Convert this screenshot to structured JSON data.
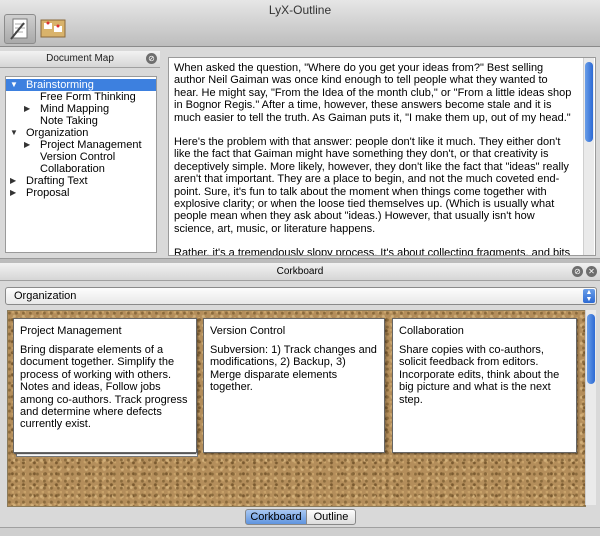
{
  "window": {
    "title": "LyX-Outline"
  },
  "document_map": {
    "header": "Document Map",
    "items": [
      {
        "label": "Brainstorming",
        "level": 0,
        "toggle": "expanded",
        "selected": true
      },
      {
        "label": "Free Form Thinking",
        "level": 1,
        "toggle": "none"
      },
      {
        "label": "Mind Mapping",
        "level": 1,
        "toggle": "collapsed"
      },
      {
        "label": "Note Taking",
        "level": 1,
        "toggle": "none"
      },
      {
        "label": "Organization",
        "level": 0,
        "toggle": "expanded"
      },
      {
        "label": "Project Management",
        "level": 1,
        "toggle": "collapsed"
      },
      {
        "label": "Version Control",
        "level": 1,
        "toggle": "none"
      },
      {
        "label": "Collaboration",
        "level": 1,
        "toggle": "none"
      },
      {
        "label": "Drafting Text",
        "level": 0,
        "toggle": "collapsed"
      },
      {
        "label": "Proposal",
        "level": 0,
        "toggle": "collapsed"
      }
    ]
  },
  "editor": {
    "paragraphs": [
      "When asked the question, \"Where do you get your ideas from?\"  Best selling author Neil Gaiman was once kind enough to tell people what they wanted to hear.  He might say, \"From the Idea of the month club,\" or \"From a little ideas shop in Bognor Regis.\"  After a time, however, these answers become stale and it is much easier to tell the truth.  As Gaiman puts it, \"I make them up, out of my head.\"",
      "Here's the problem with that answer: people don't like it much.  They either don't like the fact that Gaiman might have something they don't, or that creativity is deceptively simple.  More likely, however, they don't like the fact that \"ideas\" really aren't that important.  They are a place to begin, and not the much coveted end-point.  Sure, it's fun to talk about the moment when things come together with explosive clarity; or when the loose tied themselves up.  (Which is usually what people mean when they ask about \"ideas.)  However, that usually isn't how science, art, music, or literature happens.",
      "Rather, it's a tremendously slopy process.  It's about collecting fragments, and bits that don't make sense, old newspapers, journal entries, or equations.  These all get poured"
    ]
  },
  "corkboard": {
    "header": "Corkboard",
    "selected_section": "Organization",
    "cards": [
      {
        "title": "Project Management",
        "body": "Bring disparate elements of a document together.  Simplify the process of working with others.  Notes and ideas, Follow jobs among co-authors.  Track progress and determine where defects currently exist."
      },
      {
        "title": "Version Control",
        "body": "Subversion: 1) Track changes and modifications, 2) Backup, 3) Merge disparate elements together."
      },
      {
        "title": "Collaboration",
        "body": "Share copies with co-authors, solicit feedback from editors. Incorporate edits, think about the big picture and what is the next step."
      }
    ]
  },
  "view_toggle": {
    "corkboard": "Corkboard",
    "outline": "Outline",
    "active": "Corkboard"
  }
}
